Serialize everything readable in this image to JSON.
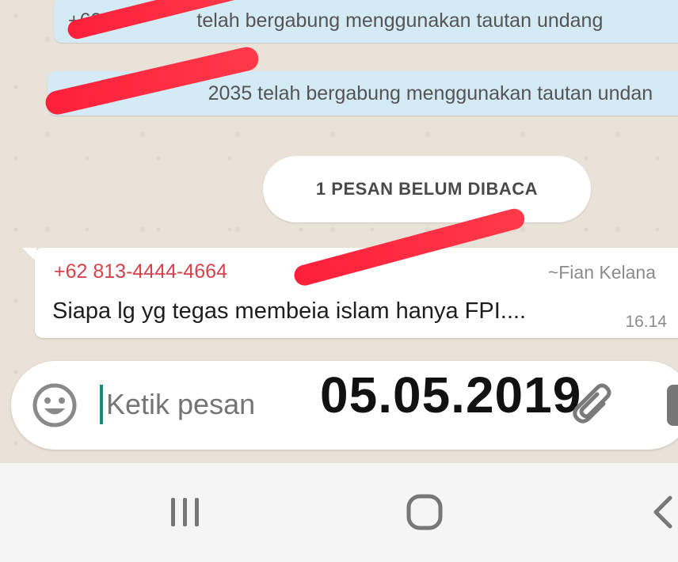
{
  "chat": {
    "system_messages": [
      {
        "visible_start": "+62",
        "text": "telah bergabung menggunakan tautan undang"
      },
      {
        "visible_start": "+",
        "text": "2035 telah bergabung menggunakan tautan undan"
      }
    ],
    "unread_banner": "1 PESAN BELUM DIBACA",
    "message": {
      "sender_number": "+62 813-4444-4664",
      "sender_name": "~Fian Kelana",
      "text": "Siapa lg yg tegas membeia islam hanya FPI....",
      "time": "16.14"
    }
  },
  "composer": {
    "placeholder": "Ketik pesan",
    "emoji_icon": "emoji-icon",
    "attach_icon": "paperclip-icon",
    "camera_icon": "camera-icon"
  },
  "overlay": {
    "date_stamp": "05.05.2019"
  },
  "navbar": {
    "recent_icon": "recent-apps-icon",
    "home_icon": "home-icon",
    "back_icon": "back-icon"
  },
  "colors": {
    "redaction": "#ff1f3a",
    "sender": "#d6424a",
    "system_bubble": "#d4eaf4",
    "cursor": "#128c7e"
  }
}
